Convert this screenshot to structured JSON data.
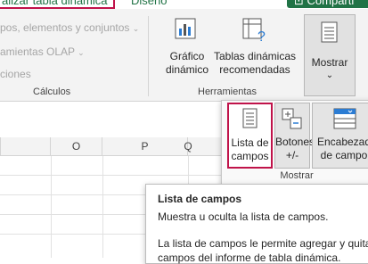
{
  "tabs": {
    "active": "alizar tabla dinámica",
    "next": "Diseño",
    "share": "Comparti"
  },
  "ribbon": {
    "menu_items": [
      "pos, elementos y conjuntos",
      "amientas OLAP",
      "ciones"
    ],
    "calculos_label": "Cálculos",
    "grafico": {
      "line1": "Gráfico",
      "line2": "dinámico"
    },
    "tablas": {
      "line1": "Tablas dinámicas",
      "line2": "recomendadas"
    },
    "herramientas_label": "Herramientas",
    "mostrar": "Mostrar"
  },
  "sheet": {
    "columns": [
      "O",
      "P",
      "Q"
    ]
  },
  "dropdown": {
    "lista": {
      "line1": "Lista de",
      "line2": "campos"
    },
    "botones": {
      "line1": "Botones",
      "line2": "+/-"
    },
    "encabezados": {
      "line1": "Encabezad",
      "line2": "de campo"
    },
    "group_label": "Mostrar"
  },
  "tooltip": {
    "title": "Lista de campos",
    "short": "Muestra u oculta la lista de campos.",
    "long_line1": "La lista de campos le permite agregar y quita",
    "long_line2": "campos del informe de tabla dinámica."
  },
  "colors": {
    "accent": "#217346",
    "highlight": "#c0134a"
  }
}
